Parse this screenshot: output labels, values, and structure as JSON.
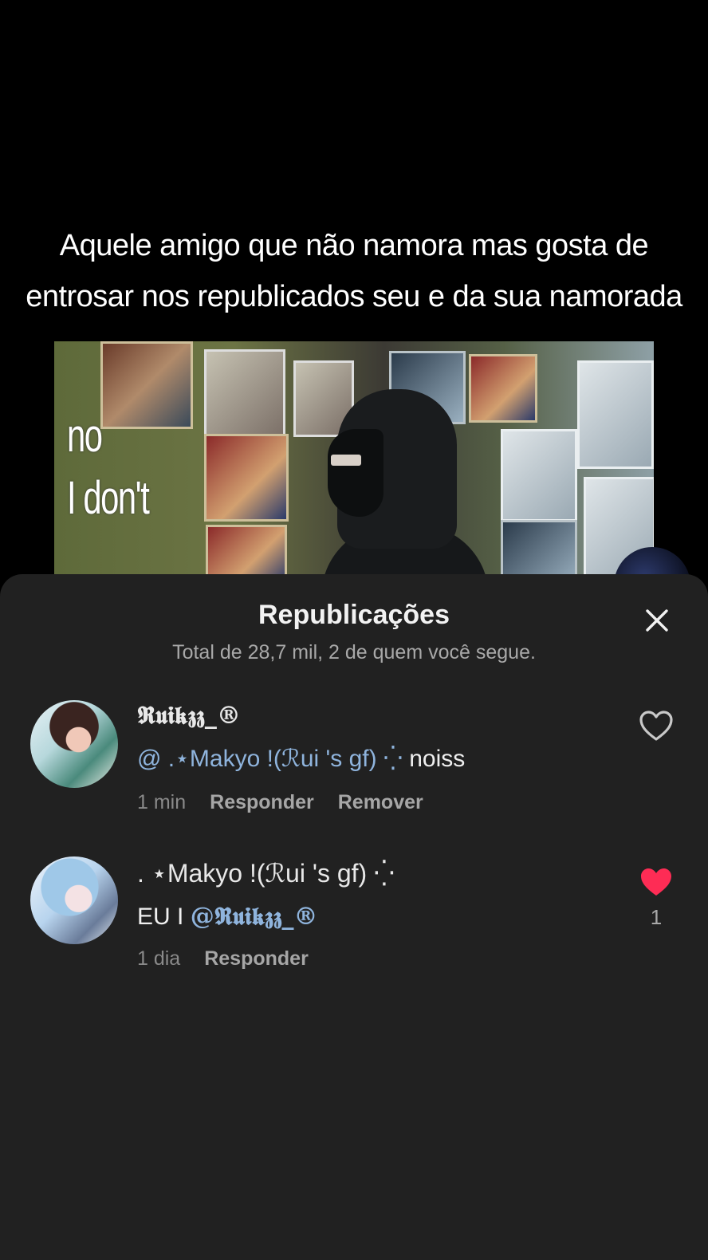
{
  "video": {
    "caption": "Aquele amigo que não namora mas gosta de entrosar nos republicados seu e da sua namorada",
    "overlay_text_line1": "no",
    "overlay_text_line2": "I don't"
  },
  "sheet": {
    "title": "Republicações",
    "subtitle": "Total de 28,7 mil, 2 de quem você segue.",
    "close_icon": "close-icon"
  },
  "comments": [
    {
      "username": "𝕽𝖚𝖎𝖐𝖟𝖟_®",
      "mention": "@ .⋆Makyo !(ℛui 's gf) ⁛",
      "text": " noiss",
      "time": "1 min",
      "reply_label": "Responder",
      "remove_label": "Remover",
      "liked": false,
      "like_count": ""
    },
    {
      "username": ". ⋆Makyo !(ℛui 's gf) ⁛",
      "text_prefix": "EU I ",
      "mention": "@𝕽𝖚𝖎𝖐𝖟𝖟_®",
      "time": "1 dia",
      "reply_label": "Responder",
      "liked": true,
      "like_count": "1"
    }
  ],
  "colors": {
    "sheet_bg": "#212121",
    "mention": "#8fb4dd",
    "like_active": "#fe2c55"
  }
}
